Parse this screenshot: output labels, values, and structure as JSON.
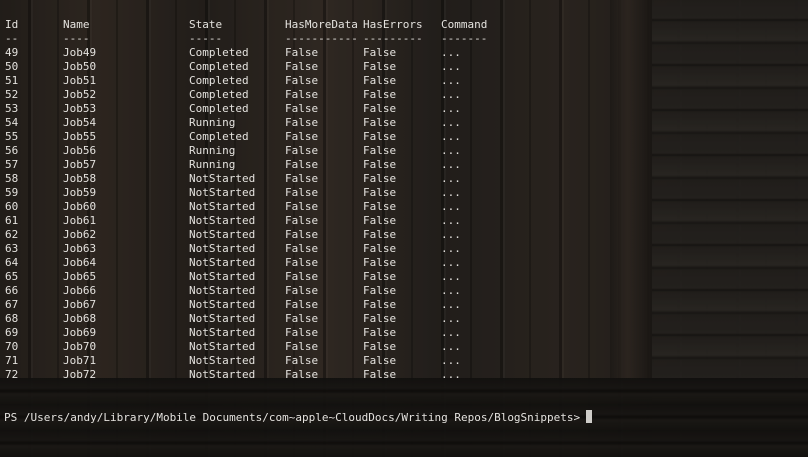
{
  "table": {
    "headers": [
      "Id",
      "Name",
      "State",
      "HasMoreData",
      "HasErrors",
      "Command"
    ],
    "separators": [
      "--",
      "----",
      "-----",
      "-----------",
      "---------",
      "-------"
    ],
    "rows": [
      [
        "49",
        "Job49",
        "Completed",
        "False",
        "False",
        "..."
      ],
      [
        "50",
        "Job50",
        "Completed",
        "False",
        "False",
        "..."
      ],
      [
        "51",
        "Job51",
        "Completed",
        "False",
        "False",
        "..."
      ],
      [
        "52",
        "Job52",
        "Completed",
        "False",
        "False",
        "..."
      ],
      [
        "53",
        "Job53",
        "Completed",
        "False",
        "False",
        "..."
      ],
      [
        "54",
        "Job54",
        "Running",
        "False",
        "False",
        "..."
      ],
      [
        "55",
        "Job55",
        "Completed",
        "False",
        "False",
        "..."
      ],
      [
        "56",
        "Job56",
        "Running",
        "False",
        "False",
        "..."
      ],
      [
        "57",
        "Job57",
        "Running",
        "False",
        "False",
        "..."
      ],
      [
        "58",
        "Job58",
        "NotStarted",
        "False",
        "False",
        "..."
      ],
      [
        "59",
        "Job59",
        "NotStarted",
        "False",
        "False",
        "..."
      ],
      [
        "60",
        "Job60",
        "NotStarted",
        "False",
        "False",
        "..."
      ],
      [
        "61",
        "Job61",
        "NotStarted",
        "False",
        "False",
        "..."
      ],
      [
        "62",
        "Job62",
        "NotStarted",
        "False",
        "False",
        "..."
      ],
      [
        "63",
        "Job63",
        "NotStarted",
        "False",
        "False",
        "..."
      ],
      [
        "64",
        "Job64",
        "NotStarted",
        "False",
        "False",
        "..."
      ],
      [
        "65",
        "Job65",
        "NotStarted",
        "False",
        "False",
        "..."
      ],
      [
        "66",
        "Job66",
        "NotStarted",
        "False",
        "False",
        "..."
      ],
      [
        "67",
        "Job67",
        "NotStarted",
        "False",
        "False",
        "..."
      ],
      [
        "68",
        "Job68",
        "NotStarted",
        "False",
        "False",
        "..."
      ],
      [
        "69",
        "Job69",
        "NotStarted",
        "False",
        "False",
        "..."
      ],
      [
        "70",
        "Job70",
        "NotStarted",
        "False",
        "False",
        "..."
      ],
      [
        "71",
        "Job71",
        "NotStarted",
        "False",
        "False",
        "..."
      ],
      [
        "72",
        "Job72",
        "NotStarted",
        "False",
        "False",
        "..."
      ]
    ]
  },
  "prompt": {
    "text": "PS /Users/andy/Library/Mobile Documents/com~apple~CloudDocs/Writing Repos/BlogSnippets>"
  },
  "colors": {
    "text": "#e4e2de",
    "cursor": "#cfcdc9"
  }
}
